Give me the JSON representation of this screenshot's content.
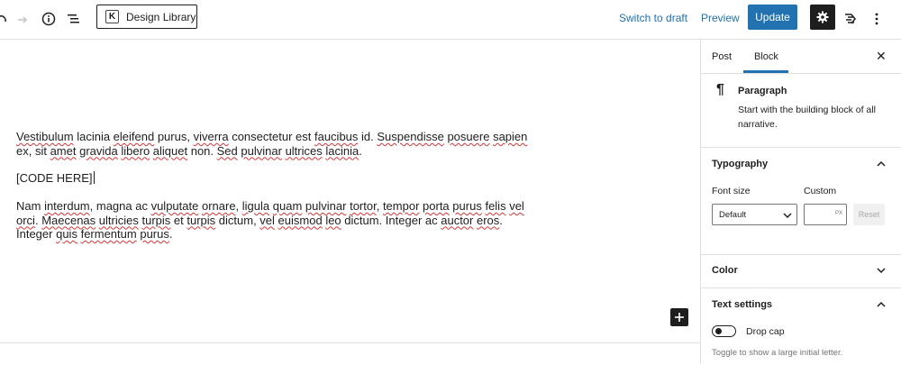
{
  "toolbar": {
    "design_library_label": "Design Library",
    "design_library_logo": "K",
    "switch_to_draft": "Switch to draft",
    "preview": "Preview",
    "update": "Update",
    "icons": [
      "undo-icon",
      "redo-icon",
      "info-icon",
      "list-view-icon",
      "gear-icon",
      "plugin-icon",
      "more-options-icon"
    ]
  },
  "editor": {
    "paragraph1_line1_parts": [
      "Vestibulum",
      " lacinia ",
      "eleifend",
      " purus, ",
      "viverra",
      " consectetur est ",
      "faucibus",
      " id. ",
      "Suspendisse",
      " ",
      "posuere",
      " ",
      "sapien"
    ],
    "paragraph1_line2_parts": [
      "ex, sit ",
      "amet",
      " ",
      "gravida",
      " ",
      "libero",
      " ",
      "aliquet",
      " non. ",
      "Sed",
      " ",
      "pulvinar",
      " ",
      "ultrices",
      " ",
      "lacinia",
      "."
    ],
    "code_block": "[CODE HERE]",
    "paragraph2_line1_parts": [
      "Nam ",
      "interdum",
      ", magna ac ",
      "vulputate",
      " ",
      "ornare",
      ", ",
      "ligula",
      " ",
      "quam",
      " ",
      "pulvinar",
      " ",
      "tortor",
      ", ",
      "tempor",
      " ",
      "porta",
      " ",
      "purus",
      " ",
      "felis",
      " ",
      "vel"
    ],
    "paragraph2_line2_parts": [
      "orci",
      ". ",
      "Maecenas",
      " ",
      "ultricies",
      " ",
      "turpis",
      " et ",
      "turpis",
      " dictum, ",
      "vel",
      " ",
      "euismod",
      " ",
      "leo",
      " dictum. Integer ac ",
      "auctor",
      " ",
      "eros",
      "."
    ],
    "paragraph2_line3_parts": [
      "Integer ",
      "quis",
      " ",
      "fermentum",
      " ",
      "purus",
      "."
    ]
  },
  "sidebar": {
    "tabs": [
      {
        "label": "Post"
      },
      {
        "label": "Block"
      }
    ],
    "active_tab": "Block",
    "block": {
      "title": "Paragraph",
      "description": "Start with the building block of all narrative."
    },
    "typography": {
      "title": "Typography",
      "font_size_label": "Font size",
      "custom_label": "Custom",
      "font_size_value": "Default",
      "custom_unit": "PX",
      "reset_label": "Reset"
    },
    "color": {
      "title": "Color"
    },
    "text_settings": {
      "title": "Text settings",
      "drop_cap_label": "Drop cap",
      "drop_cap_help": "Toggle to show a large initial letter.",
      "drop_cap_enabled": false
    }
  },
  "colors": {
    "accent": "#2271b1",
    "dark": "#1e1e1e",
    "border": "#e0e0e0",
    "spellcheck": "#d63638"
  }
}
